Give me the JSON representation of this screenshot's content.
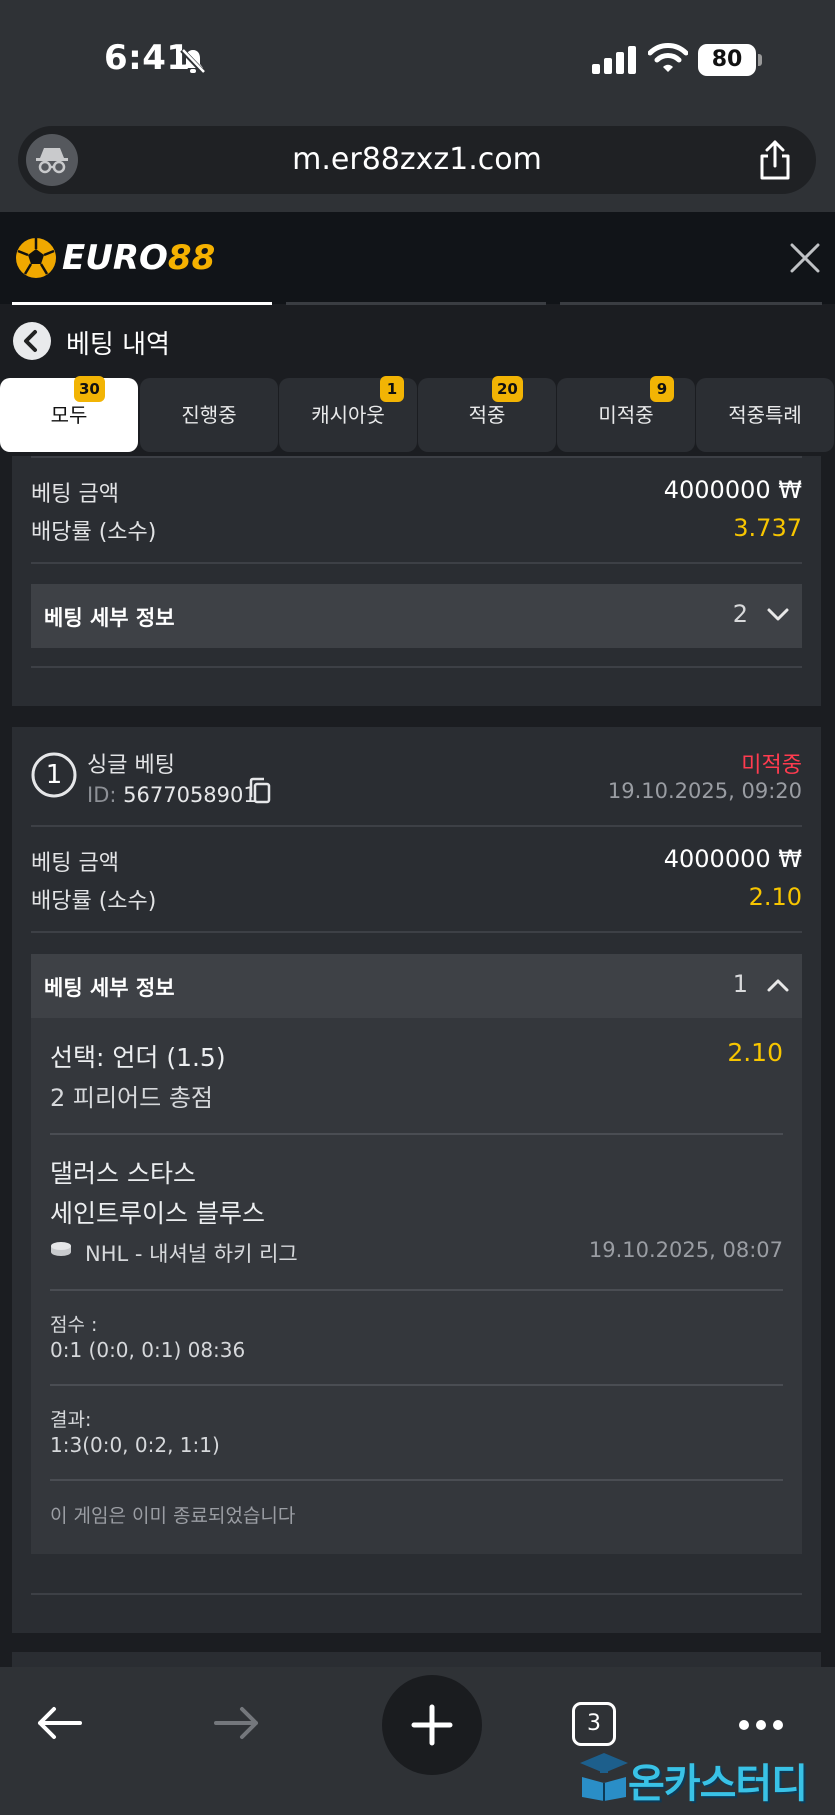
{
  "status_bar": {
    "time": "6:41",
    "battery": "80",
    "icons": [
      "bell-slash-icon",
      "signal-bars-icon",
      "wifi-icon",
      "battery-icon"
    ]
  },
  "browser": {
    "url": "m.er88zxz1.com",
    "icons": [
      "incognito-icon",
      "share-icon"
    ]
  },
  "site": {
    "logo_euro": "EURO",
    "logo_num": "88",
    "icons": [
      "soccer-ball-icon",
      "close-icon"
    ]
  },
  "page": {
    "title": "베팅 내역",
    "icons": [
      "back-arrow-icon"
    ]
  },
  "tabs": [
    {
      "label": "모두",
      "badge": "30",
      "active": true
    },
    {
      "label": "진행중",
      "badge": "",
      "active": false
    },
    {
      "label": "캐시아웃",
      "badge": "1",
      "active": false
    },
    {
      "label": "적중",
      "badge": "20",
      "active": false
    },
    {
      "label": "미적중",
      "badge": "9",
      "active": false
    },
    {
      "label": "적중특례",
      "badge": "",
      "active": false
    }
  ],
  "card1": {
    "stake_label": "베팅 금액",
    "stake_value": "4000000 ₩",
    "odds_label": "배당률 (소수)",
    "odds_value": "3.737",
    "details_label": "베팅 세부 정보",
    "details_count": "2"
  },
  "card2": {
    "number": "1",
    "type": "싱글 베팅",
    "id_label": "ID:",
    "id_value": "5677058901",
    "status": "미적중",
    "datetime": "19.10.2025, 09:20",
    "stake_label": "베팅 금액",
    "stake_value": "4000000 ₩",
    "odds_label": "배당률 (소수)",
    "odds_value": "2.10",
    "details_label": "베팅 세부 정보",
    "details_count": "1",
    "selection": "선택: 언더 (1.5)",
    "selection_odds": "2.10",
    "market": "2 피리어드 총점",
    "team_home": "댈러스 스타스",
    "team_away": "세인트루이스 블루스",
    "league": "NHL - 내셔널 하키 리그",
    "event_datetime": "19.10.2025, 08:07",
    "score_label": "점수 :",
    "score_value": "0:1 (0:0, 0:1) 08:36",
    "result_label": "결과:",
    "result_value": "1:3(0:0, 0:2, 1:1)",
    "ended_note": "이 게임은 이미 종료되었습니다"
  },
  "bottom_nav": {
    "tab_count": "3",
    "icons": [
      "back-icon",
      "forward-icon",
      "new-tab-icon",
      "tabs-icon",
      "more-icon"
    ]
  },
  "watermark": "온카스터디",
  "colors": {
    "accent_yellow": "#f7c500",
    "badge_yellow": "#f2b404",
    "loss_red": "#ff3b4f",
    "card_bg": "#2a2d32"
  }
}
